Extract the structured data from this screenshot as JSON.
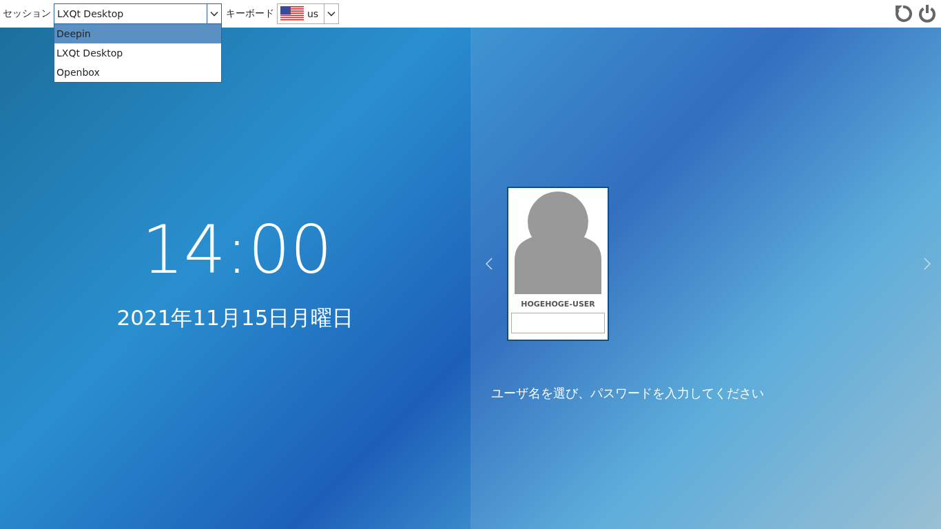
{
  "top_bar": {
    "session_label": "セッション",
    "session_select": {
      "value": "LXQt Desktop",
      "expanded": true,
      "options": [
        {
          "label": "Deepin",
          "highlighted": true
        },
        {
          "label": "LXQt Desktop",
          "highlighted": false
        },
        {
          "label": "Openbox",
          "highlighted": false
        }
      ]
    },
    "keyboard_label": "キーボード",
    "keyboard_select": {
      "value": "us"
    }
  },
  "clock": {
    "time": "14:00",
    "date": "2021年11月15日月曜日"
  },
  "user_card": {
    "username": "HOGEHOGE-USER"
  },
  "message": "ユーザ名を選び、パスワードを入力してください"
}
